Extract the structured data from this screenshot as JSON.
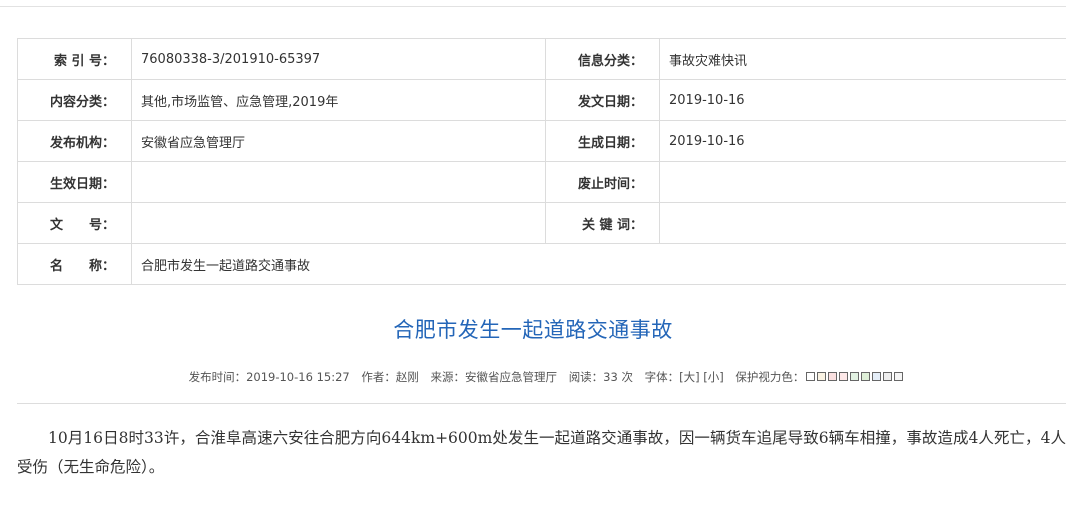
{
  "meta": {
    "index_label": "索 引 号：",
    "index_value": "76080338-3/201910-65397",
    "category_label": "信息分类：",
    "category_value": "事故灾难快讯",
    "content_label": "内容分类：",
    "content_value": "其他,市场监管、应急管理,2019年",
    "issue_date_label": "发文日期：",
    "issue_date_value": "2019-10-16",
    "publisher_label": "发布机构：",
    "publisher_value": "安徽省应急管理厅",
    "gen_date_label": "生成日期：",
    "gen_date_value": "2019-10-16",
    "effective_label": "生效日期：",
    "effective_value": "",
    "abolish_label": "废止时间：",
    "abolish_value": "",
    "docno_label": "文　　号：",
    "docno_value": "",
    "keyword_label": "关 键 词：",
    "keyword_value": "",
    "name_label": "名　　称：",
    "name_value": "合肥市发生一起道路交通事故"
  },
  "article": {
    "title": "合肥市发生一起道路交通事故",
    "publish_time": "发布时间：2019-10-16 15:27",
    "author": "作者：赵刚",
    "source": "来源：安徽省应急管理厅",
    "reads": "阅读：33 次",
    "font_size_label": "字体：",
    "font_large": "[大]",
    "font_small": "[小]",
    "eye_protect_label": "保护视力色：",
    "eye_colors": [
      "#ffffff",
      "#faf3e3",
      "#fbe1e1",
      "#fde8e8",
      "#e2f2e2",
      "#dff0d8",
      "#e5eef8",
      "#eeeeee",
      "#f5f5f5"
    ],
    "body": "10月16日8时33许，合淮阜高速六安往合肥方向644km+600m处发生一起道路交通事故，因一辆货车追尾导致6辆车相撞，事故造成4人死亡，4人受伤（无生命危险）。"
  }
}
